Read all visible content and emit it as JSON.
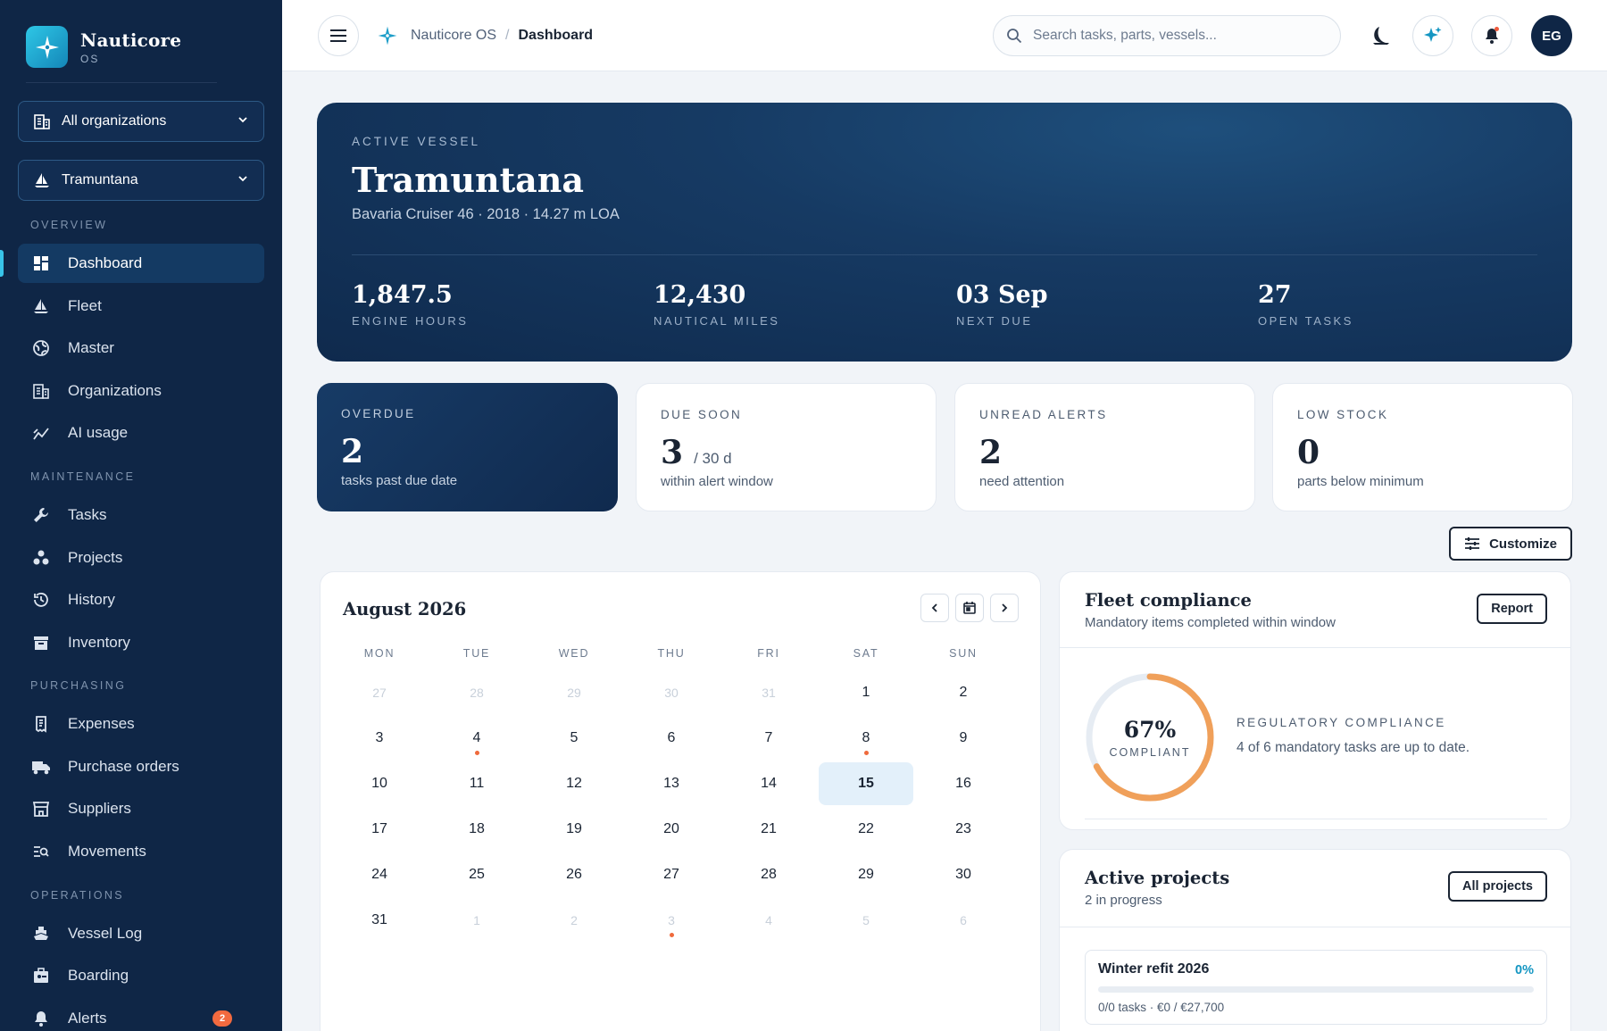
{
  "brand": {
    "name": "Nauticore",
    "sub": "OS"
  },
  "selectors": {
    "organization": "All organizations",
    "vessel": "Tramuntana"
  },
  "nav": {
    "overview_label": "OVERVIEW",
    "maintenance_label": "MAINTENANCE",
    "purchasing_label": "PURCHASING",
    "operations_label": "OPERATIONS",
    "overview": [
      {
        "label": "Dashboard",
        "icon": "dashboard-icon",
        "active": true
      },
      {
        "label": "Fleet",
        "icon": "sailboat-icon"
      },
      {
        "label": "Master",
        "icon": "globe-icon"
      },
      {
        "label": "Organizations",
        "icon": "building-icon"
      },
      {
        "label": "AI usage",
        "icon": "chart-icon"
      }
    ],
    "maintenance": [
      {
        "label": "Tasks",
        "icon": "wrench-icon"
      },
      {
        "label": "Projects",
        "icon": "projects-icon"
      },
      {
        "label": "History",
        "icon": "history-icon"
      },
      {
        "label": "Inventory",
        "icon": "archive-icon"
      }
    ],
    "purchasing": [
      {
        "label": "Expenses",
        "icon": "receipt-icon"
      },
      {
        "label": "Purchase orders",
        "icon": "truck-icon"
      },
      {
        "label": "Suppliers",
        "icon": "store-icon"
      },
      {
        "label": "Movements",
        "icon": "movements-icon"
      }
    ],
    "operations": [
      {
        "label": "Vessel Log",
        "icon": "ship-icon"
      },
      {
        "label": "Boarding",
        "icon": "boarding-icon"
      },
      {
        "label": "Alerts",
        "icon": "bell-icon",
        "badge": "2"
      }
    ]
  },
  "topbar": {
    "breadcrumb_root": "Nauticore OS",
    "breadcrumb_sep": "/",
    "breadcrumb_current": "Dashboard",
    "search_placeholder": "Search tasks, parts, vessels...",
    "avatar_initials": "EG"
  },
  "hero": {
    "kicker": "ACTIVE VESSEL",
    "title": "Tramuntana",
    "subtitle": "Bavaria Cruiser 46 · 2018 · 14.27 m LOA",
    "stats": [
      {
        "value": "1,847.5",
        "label": "ENGINE HOURS"
      },
      {
        "value": "12,430",
        "label": "NAUTICAL MILES"
      },
      {
        "value": "03 Sep",
        "label": "NEXT DUE"
      },
      {
        "value": "27",
        "label": "OPEN TASKS"
      }
    ]
  },
  "kpis": [
    {
      "label": "OVERDUE",
      "value": "2",
      "unit": "",
      "note": "tasks past due date"
    },
    {
      "label": "DUE SOON",
      "value": "3",
      "unit": "/ 30 d",
      "note": "within alert window"
    },
    {
      "label": "UNREAD ALERTS",
      "value": "2",
      "unit": "",
      "note": "need attention"
    },
    {
      "label": "LOW STOCK",
      "value": "0",
      "unit": "",
      "note": "parts below minimum"
    }
  ],
  "customize_label": "Customize",
  "calendar": {
    "title": "August 2026",
    "weekdays": [
      "MON",
      "TUE",
      "WED",
      "THU",
      "FRI",
      "SAT",
      "SUN"
    ],
    "weeks": [
      [
        "27",
        "28",
        "29",
        "30",
        "31",
        "1",
        "2"
      ],
      [
        "3",
        "4",
        "5",
        "6",
        "7",
        "8",
        "9"
      ],
      [
        "10",
        "11",
        "12",
        "13",
        "14",
        "15",
        "16"
      ],
      [
        "17",
        "18",
        "19",
        "20",
        "21",
        "22",
        "23"
      ],
      [
        "24",
        "25",
        "26",
        "27",
        "28",
        "29",
        "30"
      ],
      [
        "31",
        "1",
        "2",
        "3",
        "4",
        "5",
        "6"
      ]
    ],
    "muted_cells": [
      "0-0",
      "0-1",
      "0-2",
      "0-3",
      "0-4",
      "5-1",
      "5-2",
      "5-3",
      "5-4",
      "5-5",
      "5-6"
    ],
    "today_cell": "2-5",
    "event_cells": [
      "1-1",
      "1-5",
      "5-3"
    ]
  },
  "compliance": {
    "title": "Fleet compliance",
    "subtitle": "Mandatory items completed within window",
    "button": "Report",
    "percent_text": "67%",
    "percent_value": 67,
    "percent_label": "COMPLIANT",
    "kicker": "REGULATORY COMPLIANCE",
    "description": "4 of 6 mandatory tasks are up to date.",
    "ring_color": "#f0a05a",
    "track_color": "#e6ecf3"
  },
  "projects": {
    "title": "Active projects",
    "subtitle": "2 in progress",
    "button": "All projects",
    "items": [
      {
        "name": "Winter refit 2026",
        "percent_text": "0%",
        "progress": 0,
        "meta": "0/0 tasks · €0 / €27,700"
      }
    ]
  }
}
